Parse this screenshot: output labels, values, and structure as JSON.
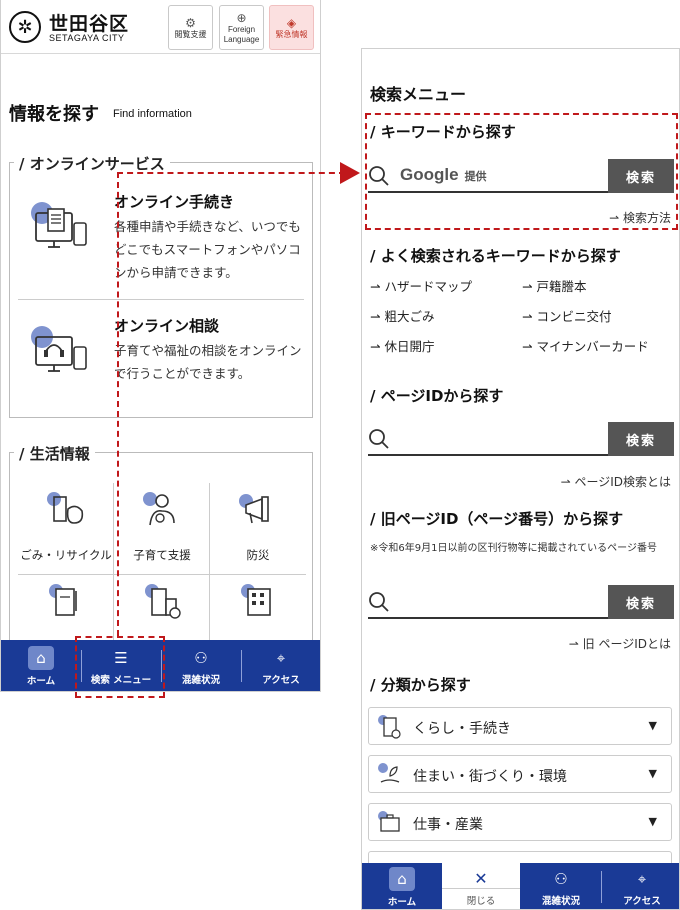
{
  "left": {
    "header": {
      "logo_name": "世田谷区",
      "logo_sub": "SETAGAYA CITY",
      "browse_label": "閲覧支援",
      "lang_label": "Foreign\nLanguage",
      "emergency_label": "緊急情報"
    },
    "find": {
      "title": "情報を探す",
      "sub": "Find information"
    },
    "online": {
      "title": "/ オンラインサービス",
      "procedure": {
        "title": "オンライン手続き",
        "desc": "各種申請や手続きなど、いつでもどこでもスマートフォンやパソコンから申請できます。"
      },
      "consult": {
        "title": "オンライン相談",
        "desc": "子育てや福祉の相談をオンラインで行うことができます。"
      }
    },
    "life": {
      "title": "/ 生活情報",
      "items": [
        "ごみ・リサイクル",
        "子育て支援",
        "防災"
      ]
    },
    "nav": {
      "home": "ホーム",
      "search": "検索 メニュー",
      "crowd": "混雑状況",
      "access": "アクセス"
    }
  },
  "right": {
    "title": "検索メニュー",
    "keyword": {
      "heading": "/ キーワードから探す",
      "google_label": "Google",
      "google_suffix": "提供",
      "button": "検索",
      "help_link": "⇀ 検索方法"
    },
    "popular": {
      "heading": "/ よく検索されるキーワードから探す",
      "keywords": [
        "⇀ ハザードマップ",
        "⇀ 戸籍謄本",
        "⇀ 粗大ごみ",
        "⇀ コンビニ交付",
        "⇀ 休日開庁",
        "⇀ マイナンバーカード"
      ]
    },
    "page_id": {
      "heading": "/ ページIDから探す",
      "button": "検索",
      "help_link": "⇀ ページID検索とは"
    },
    "old_page_id": {
      "heading": "/ 旧ページID（ページ番号）から探す",
      "note": "※令和6年9月1日以前の区刊行物等に掲載されているページ番号",
      "button": "検索",
      "help_link": "⇀ 旧 ページIDとは"
    },
    "category": {
      "heading": "/ 分類から探す",
      "items": [
        "くらし・手続き",
        "住まい・街づくり・環境",
        "仕事・産業"
      ]
    },
    "nav": {
      "home": "ホーム",
      "close": "閉じる",
      "crowd": "混雑状況",
      "access": "アクセス"
    }
  },
  "colors": {
    "nav_blue": "#1a3a96",
    "annotation_red": "#c0181b",
    "emergency_bg": "#fbe0e0"
  }
}
